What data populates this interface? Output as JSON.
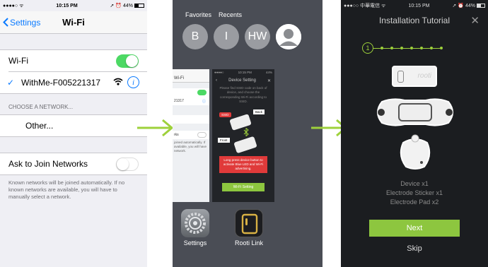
{
  "panel1": {
    "status": {
      "carrier": "●●●●○",
      "wifi": "ᯤ",
      "time": "10:15 PM",
      "battery": "➚ ⏰ 44%"
    },
    "nav": {
      "back_label": "Settings",
      "title": "Wi-Fi"
    },
    "wifi_label": "Wi-Fi",
    "connected_network": "WithMe-F005221317",
    "choose_header": "CHOOSE A NETWORK...",
    "other_label": "Other...",
    "ask_label": "Ask to Join Networks",
    "footer": "Known networks will be joined automatically. If no known networks are available, you will have to manually select a network."
  },
  "panel2": {
    "tabs": {
      "favorites": "Favorites",
      "recents": "Recents"
    },
    "contacts": [
      "B",
      "I",
      "HW"
    ],
    "mini_phone": {
      "title": "Wi-Fi",
      "network_fragment": "21317",
      "label_fragment": "rks",
      "footer_fragment": "joined automatically. If available, you will have network."
    },
    "mini_app": {
      "time": "10:15 PM",
      "title": "Device Setting",
      "instruction": "Please find SSID code on back of device, and choose the corresponding Wi-Fi according to SSID.",
      "ssid_tag": "SSID",
      "back_tag": "Back",
      "front_tag": "Front",
      "warning": "Long press device button to activate Blue LED and Wi-Fi advertising.",
      "button": "Wi-Fi Setting"
    },
    "apps": [
      {
        "label": "Settings"
      },
      {
        "label": "Rooti Link"
      }
    ]
  },
  "panel3": {
    "status": {
      "carrier": "●●●○○ 中華電信 ᯤ",
      "time": "10:15 PM",
      "battery": "➚ ⏰ 44%"
    },
    "title": "Installation Tutorial",
    "current_step": "1",
    "device_text": "rooti",
    "items": [
      "Device x1",
      "Electrode Sticker x1",
      "Electrode Pad x2"
    ],
    "next_label": "Next",
    "skip_label": "Skip"
  },
  "colors": {
    "ios_blue": "#0a7aff",
    "ios_green": "#4cd964",
    "accent_green": "#8dc63f",
    "arrow_green": "#9ed13b"
  }
}
